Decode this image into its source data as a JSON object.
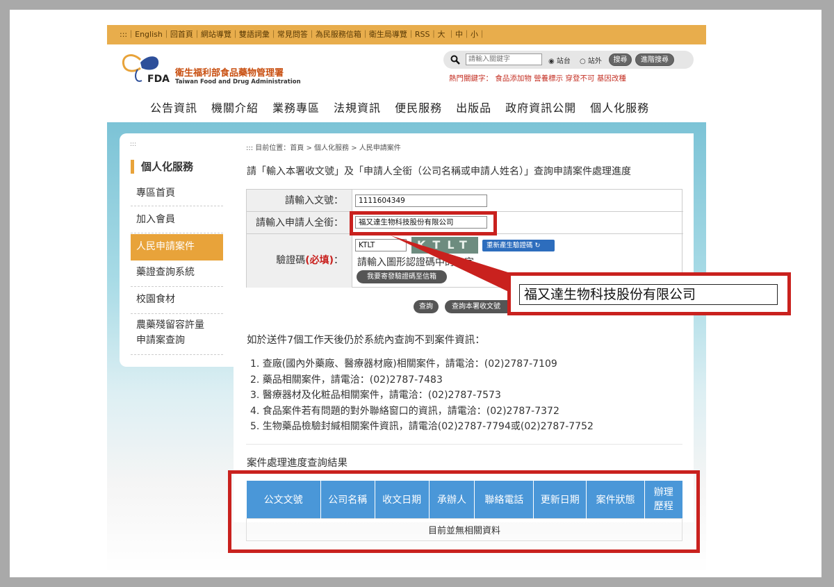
{
  "topbar": {
    "links": ":::｜English｜回首頁｜網站導覽｜雙語詞彙｜常見問答｜為民服務信箱｜衛生局導覽｜RSS｜大 ｜中｜小｜"
  },
  "logo": {
    "name_cn": "衛生福利部食品藥物管理署",
    "name_en": "Taiwan Food and Drug Administration",
    "mark": "FDA"
  },
  "search": {
    "placeholder": "請輸入關鍵字",
    "radio_site": "站台",
    "radio_outside": "站外",
    "search_button": "搜尋",
    "advanced_button": "進階搜尋",
    "hot_keywords": "熱門關鍵字： 食品添加物 營養標示 穿登不可 基因改種"
  },
  "main_nav": [
    "公告資訊",
    "機關介紹",
    "業務專區",
    "法規資訊",
    "便民服務",
    "出版品",
    "政府資訊公開",
    "個人化服務"
  ],
  "sidebar": {
    "dots": ":::",
    "title": "個人化服務",
    "items": [
      {
        "label": "專區首頁"
      },
      {
        "label": "加入會員"
      },
      {
        "label": "人民申請案件"
      },
      {
        "label": "藥證查詢系統"
      },
      {
        "label": "校園食材"
      },
      {
        "label": "農藥殘留容許量",
        "label2": "申請案查詢"
      }
    ]
  },
  "breadcrumb": "::: 目前位置：首頁 > 個人化服務 > 人民申請案件",
  "instruction": "請「輸入本署收文號」及「申請人全銜（公司名稱或申請人姓名）」查詢申請案件處理進度",
  "form": {
    "doc_no_label": "請輸入文號：",
    "doc_no_value": "1111604349",
    "applicant_label": "請輸入申請人全銜：",
    "applicant_value": "福又達生物科技股份有限公司",
    "captcha_label": "驗證碼",
    "captcha_required": "(必填)",
    "captcha_colon": "：",
    "captcha_value": "KTLT",
    "captcha_image_text": "KTLT",
    "refresh_captcha": "重新產生驗證碼",
    "captcha_hint": "請輸入圖形認證碼中的文字",
    "email_captcha": "我要寄發驗證碼至信箱",
    "query_button": "查詢",
    "query_all_button": "查詢本署收文號"
  },
  "callout": {
    "value": "福又達生物科技股份有限公司"
  },
  "note": "如於送件7個工作天後仍於系統內查詢不到案件資訊：",
  "contacts": [
    "1. 查廠(國內外藥廠、醫療器材廠)相關案件，請電洽：(02)2787-7109",
    "2. 藥品相關案件，請電洽：(02)2787-7483",
    "3. 醫療器材及化粧品相關案件，請電洽：(02)2787-7573",
    "4. 食品案件若有問題的對外聯絡窗口的資訊，請電洽：(02)2787-7372",
    "5. 生物藥品檢驗封緘相關案件資訊，請電洽(02)2787-7794或(02)2787-7752"
  ],
  "result": {
    "title": "案件處理進度查詢結果",
    "headers": [
      "公文文號",
      "公司名稱",
      "收文日期",
      "承辦人",
      "聯絡電話",
      "更新日期",
      "案件狀態",
      "辦理",
      "歷程"
    ],
    "empty": "目前並無相關資料"
  },
  "colors": {
    "topbar": "#e8ad4c",
    "accent": "#e8a33a",
    "table_header": "#4a97d8",
    "highlight": "#c9211e"
  }
}
